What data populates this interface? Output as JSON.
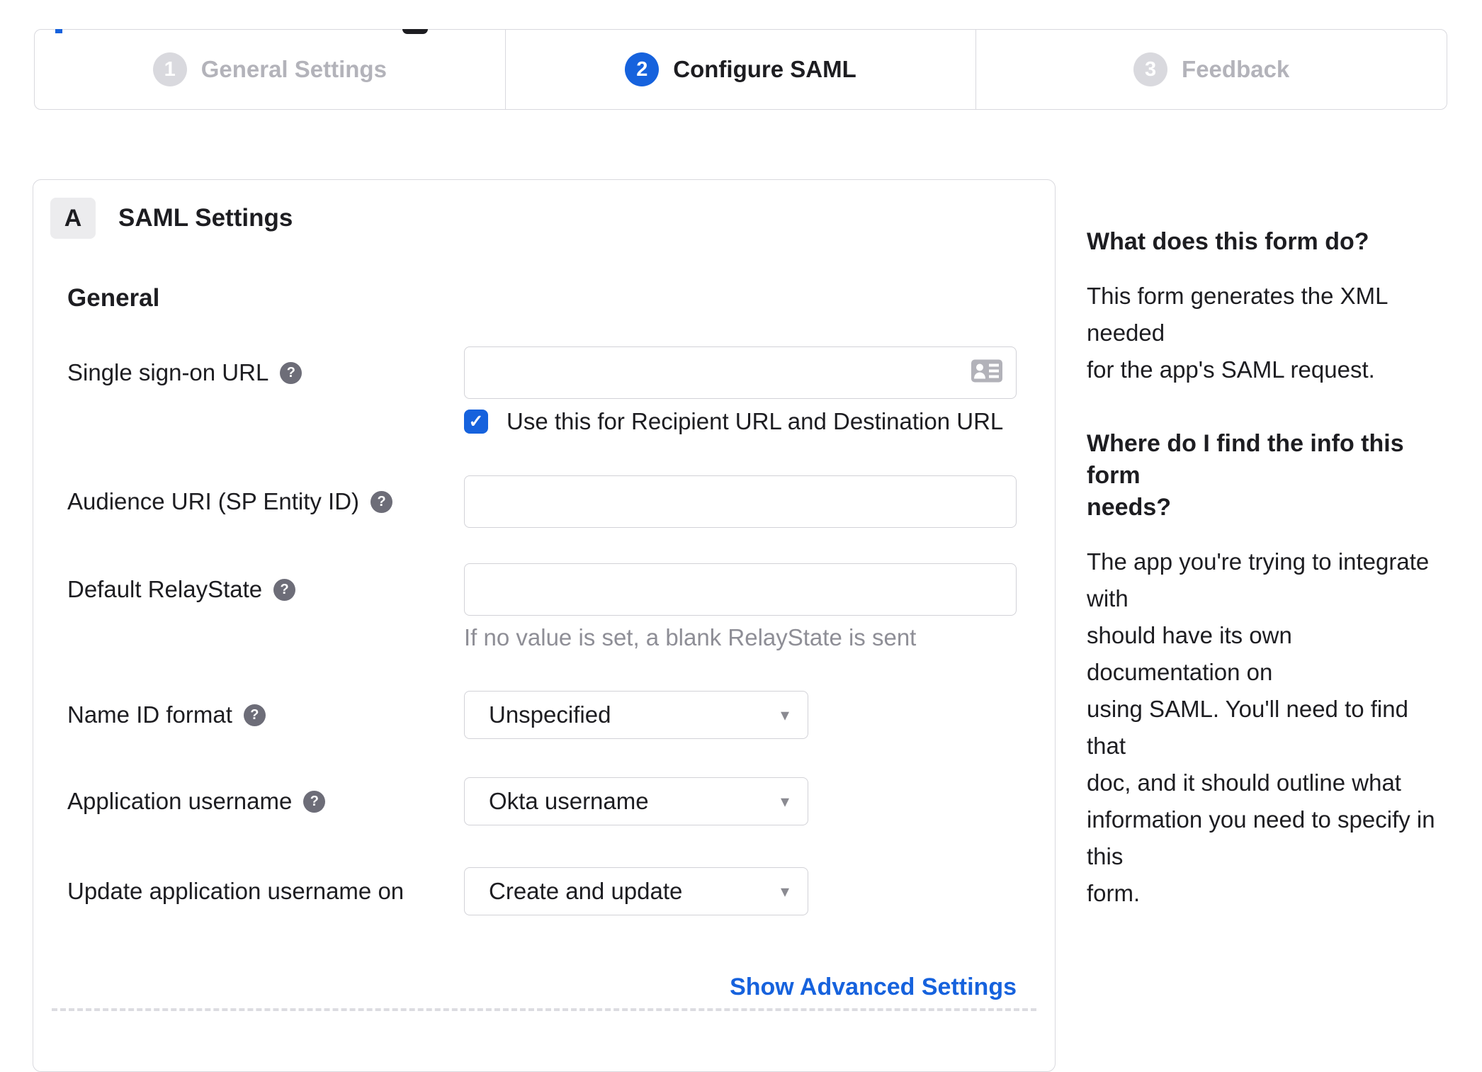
{
  "stepper": {
    "steps": [
      {
        "number": "1",
        "label": "General Settings",
        "state": "done"
      },
      {
        "number": "2",
        "label": "Configure SAML",
        "state": "active"
      },
      {
        "number": "3",
        "label": "Feedback",
        "state": "upcoming"
      }
    ]
  },
  "form": {
    "section_badge": "A",
    "section_title": "SAML Settings",
    "group_title": "General",
    "sso": {
      "label": "Single sign-on URL",
      "value": ""
    },
    "sso_checkbox": {
      "label": "Use this for Recipient URL and Destination URL",
      "checked": true,
      "checkmark": "✓"
    },
    "audience": {
      "label": "Audience URI (SP Entity ID)",
      "value": ""
    },
    "relay": {
      "label": "Default RelayState",
      "value": "",
      "hint": "If no value is set, a blank RelayState is sent"
    },
    "nameid": {
      "label": "Name ID format",
      "value": "Unspecified"
    },
    "appuser": {
      "label": "Application username",
      "value": "Okta username"
    },
    "updateuser": {
      "label": "Update application username on",
      "value": "Create and update"
    },
    "help_icon_glyph": "?",
    "caret_glyph": "▾",
    "advanced_link": "Show Advanced Settings"
  },
  "sidebar": {
    "section1": {
      "heading": "What does this form do?",
      "body_lines": [
        "This form generates the XML needed",
        "for the app's SAML request."
      ]
    },
    "section2": {
      "heading_lines": [
        "Where do I find the info this form",
        "needs?"
      ],
      "body_lines": [
        "The app you're trying to integrate with",
        "should have its own documentation on",
        "using SAML. You'll need to find that",
        "doc, and it should outline what",
        "information you need to specify in this",
        "form."
      ]
    }
  },
  "colors": {
    "accent_blue": "#1662dd",
    "step_inactive_circle": "#d9d9de",
    "inactive_text": "#b3b3ba",
    "dark_text": "#1d1d21",
    "border": "#d9d9de",
    "hint_text": "#8e8e96",
    "help_icon_bg": "#6d6d78",
    "field_icon_gray": "#b2b2b9"
  }
}
